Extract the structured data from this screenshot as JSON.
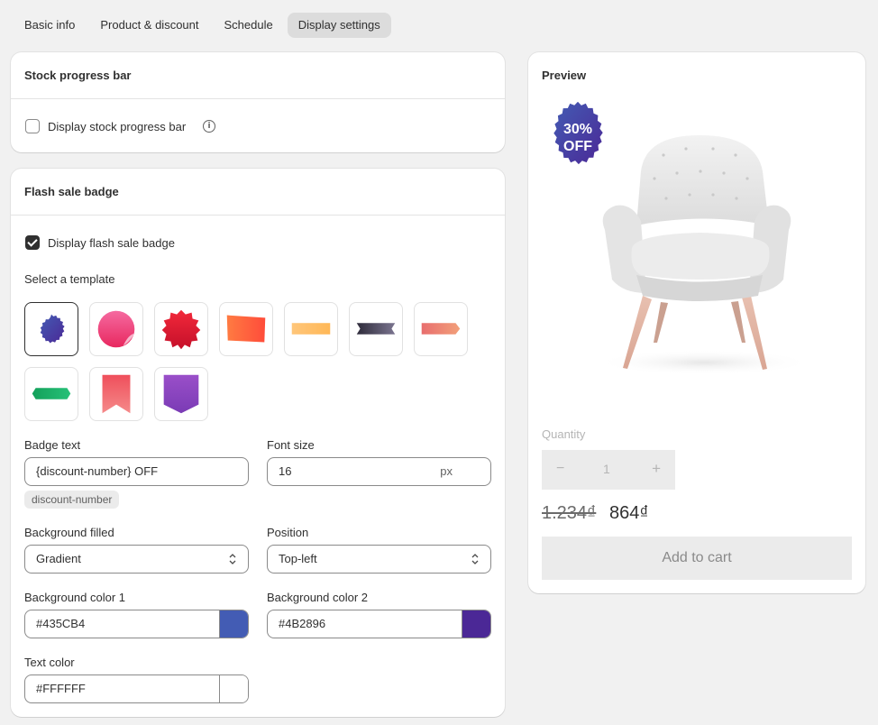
{
  "tabs": [
    {
      "label": "Basic info",
      "active": false
    },
    {
      "label": "Product & discount",
      "active": false
    },
    {
      "label": "Schedule",
      "active": false
    },
    {
      "label": "Display settings",
      "active": true
    }
  ],
  "stock_card": {
    "title": "Stock progress bar",
    "checkbox_label": "Display stock progress bar",
    "checked": false
  },
  "badge_card": {
    "title": "Flash sale badge",
    "checkbox_label": "Display flash sale badge",
    "checked": true,
    "template_label": "Select a template",
    "templates": [
      "seal-badge",
      "circle-sticker",
      "burst-badge",
      "tag-badge",
      "ribbon-yellow",
      "ribbon-dark",
      "ribbon-arrow",
      "ribbon-green",
      "bookmark-badge",
      "shield-badge"
    ],
    "selected_template": 0,
    "badge_text_label": "Badge text",
    "badge_text_value": "{discount-number} OFF",
    "badge_text_chip": "discount-number",
    "font_size_label": "Font size",
    "font_size_value": "16",
    "font_size_unit": "px",
    "bg_filled_label": "Background filled",
    "bg_filled_value": "Gradient",
    "position_label": "Position",
    "position_value": "Top-left",
    "bg_color1_label": "Background color 1",
    "bg_color1_value": "#435CB4",
    "bg_color2_label": "Background color 2",
    "bg_color2_value": "#4B2896",
    "text_color_label": "Text color",
    "text_color_value": "#FFFFFF"
  },
  "preview": {
    "title": "Preview",
    "badge_line1": "30%",
    "badge_line2": "OFF",
    "quantity_label": "Quantity",
    "quantity_minus": "−",
    "quantity_value": "1",
    "quantity_plus": "+",
    "price_old": "1.234₫",
    "price_new": "864₫",
    "add_to_cart": "Add to cart"
  }
}
